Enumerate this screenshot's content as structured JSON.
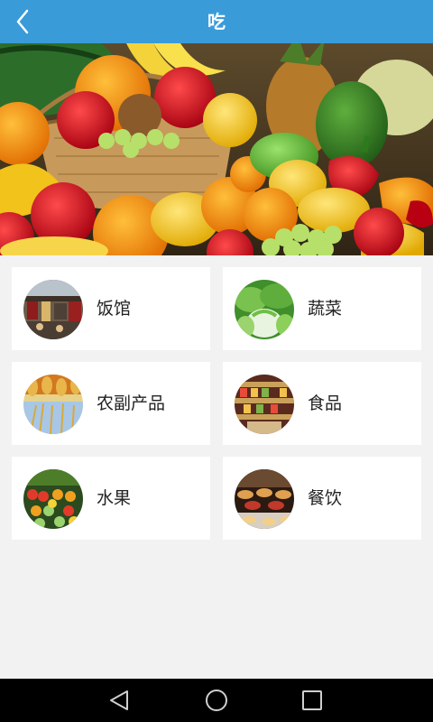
{
  "header": {
    "title": "吃",
    "back_icon": "chevron-left-icon",
    "background": "#3a9bd9"
  },
  "banner": {
    "subject": "fruit-basket-photo"
  },
  "categories": [
    {
      "label": "饭馆",
      "icon": "restaurant-street-photo"
    },
    {
      "label": "蔬菜",
      "icon": "vegetables-photo"
    },
    {
      "label": "农副产品",
      "icon": "farm-produce-photo"
    },
    {
      "label": "食品",
      "icon": "food-store-photo"
    },
    {
      "label": "水果",
      "icon": "fruit-stall-photo"
    },
    {
      "label": "餐饮",
      "icon": "dining-buffet-photo"
    }
  ],
  "navbar": {
    "back_icon": "triangle-back-icon",
    "home_icon": "circle-home-icon",
    "recent_icon": "square-recents-icon"
  }
}
